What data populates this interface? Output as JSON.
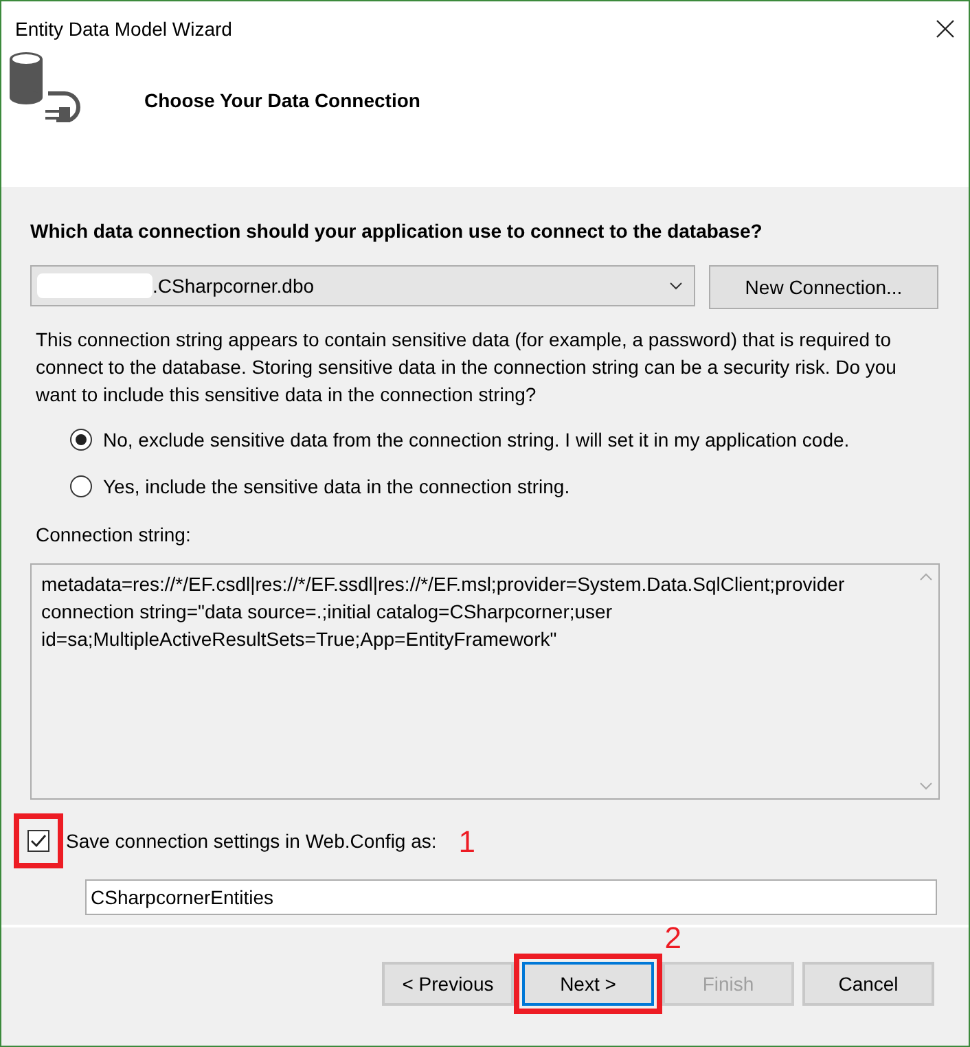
{
  "window": {
    "title": "Entity Data Model Wizard"
  },
  "header": {
    "title": "Choose Your Data Connection"
  },
  "question": "Which data connection should your application use to connect to the database?",
  "connection": {
    "value": ".CSharpcorner.dbo",
    "new_button": "New Connection..."
  },
  "warning": "This connection string appears to contain sensitive data (for example, a password) that is required to connect to the database. Storing sensitive data in the connection string can be a security risk. Do you want to include this sensitive data in the connection string?",
  "options": [
    {
      "label": "No, exclude sensitive data from the connection string. I will set it in my application code.",
      "selected": true
    },
    {
      "label": "Yes, include the sensitive data in the connection string.",
      "selected": false
    }
  ],
  "connection_string": {
    "label": "Connection string:",
    "value": "metadata=res://*/EF.csdl|res://*/EF.ssdl|res://*/EF.msl;provider=System.Data.SqlClient;provider connection string=\"data source=.;initial catalog=CSharpcorner;user id=sa;MultipleActiveResultSets=True;App=EntityFramework\""
  },
  "save": {
    "label": "Save connection settings in Web.Config as:",
    "checked": true,
    "annotation": "1",
    "name": "CSharpcornerEntities"
  },
  "buttons": [
    {
      "label": "< Previous",
      "disabled": false,
      "focused": false
    },
    {
      "label": "Next >",
      "disabled": false,
      "focused": true,
      "annotation": "2"
    },
    {
      "label": "Finish",
      "disabled": true,
      "focused": false
    },
    {
      "label": "Cancel",
      "disabled": false,
      "focused": false
    }
  ]
}
